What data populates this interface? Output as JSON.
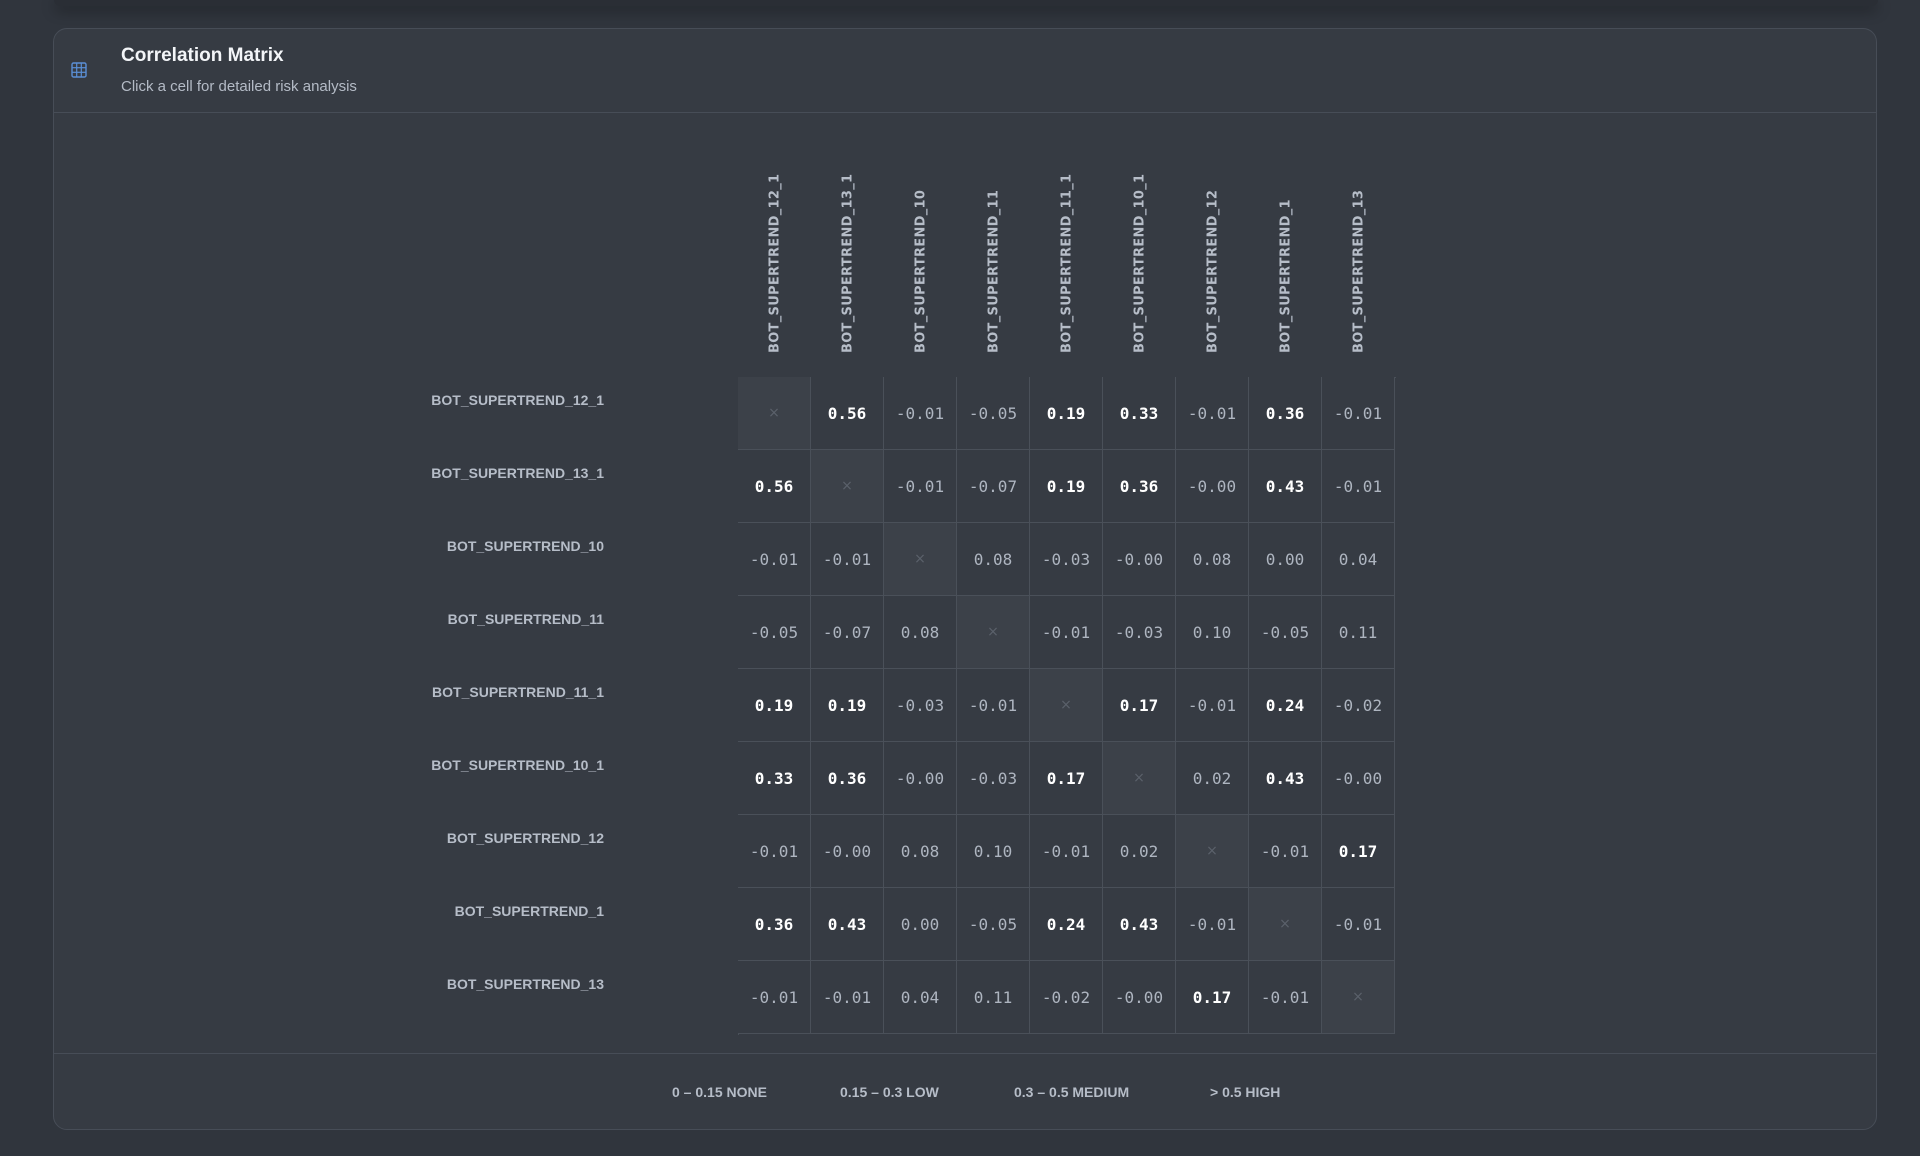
{
  "header": {
    "title": "Correlation Matrix",
    "subtitle": "Click a cell for detailed risk analysis",
    "icon": "grid-table-icon",
    "icon_color": "#5b8fd6"
  },
  "matrix": {
    "labels": [
      "BOT_SUPERTREND_12_1",
      "BOT_SUPERTREND_13_1",
      "BOT_SUPERTREND_10",
      "BOT_SUPERTREND_11",
      "BOT_SUPERTREND_11_1",
      "BOT_SUPERTREND_10_1",
      "BOT_SUPERTREND_12",
      "BOT_SUPERTREND_1",
      "BOT_SUPERTREND_13"
    ],
    "diagonal_symbol": "×",
    "values": [
      [
        "×",
        "0.56",
        "-0.01",
        "-0.05",
        "0.19",
        "0.33",
        "-0.01",
        "0.36",
        "-0.01"
      ],
      [
        "0.56",
        "×",
        "-0.01",
        "-0.07",
        "0.19",
        "0.36",
        "-0.00",
        "0.43",
        "-0.01"
      ],
      [
        "-0.01",
        "-0.01",
        "×",
        "0.08",
        "-0.03",
        "-0.00",
        "0.08",
        "0.00",
        "0.04"
      ],
      [
        "-0.05",
        "-0.07",
        "0.08",
        "×",
        "-0.01",
        "-0.03",
        "0.10",
        "-0.05",
        "0.11"
      ],
      [
        "0.19",
        "0.19",
        "-0.03",
        "-0.01",
        "×",
        "0.17",
        "-0.01",
        "0.24",
        "-0.02"
      ],
      [
        "0.33",
        "0.36",
        "-0.00",
        "-0.03",
        "0.17",
        "×",
        "0.02",
        "0.43",
        "-0.00"
      ],
      [
        "-0.01",
        "-0.00",
        "0.08",
        "0.10",
        "-0.01",
        "0.02",
        "×",
        "-0.01",
        "0.17"
      ],
      [
        "0.36",
        "0.43",
        "0.00",
        "-0.05",
        "0.24",
        "0.43",
        "-0.01",
        "×",
        "-0.01"
      ],
      [
        "-0.01",
        "-0.01",
        "0.04",
        "0.11",
        "-0.02",
        "-0.00",
        "0.17",
        "-0.01",
        "×"
      ]
    ]
  },
  "legend": [
    {
      "label": "0 – 0.15 NONE"
    },
    {
      "label": "0.15 – 0.3 LOW"
    },
    {
      "label": "0.3 – 0.5 MEDIUM"
    },
    {
      "label": "> 0.5 HIGH"
    }
  ],
  "colors": {
    "page_bg": "#30353d",
    "card_bg": "#363b43",
    "border": "#474d57",
    "accent": "#5b8fd6"
  }
}
